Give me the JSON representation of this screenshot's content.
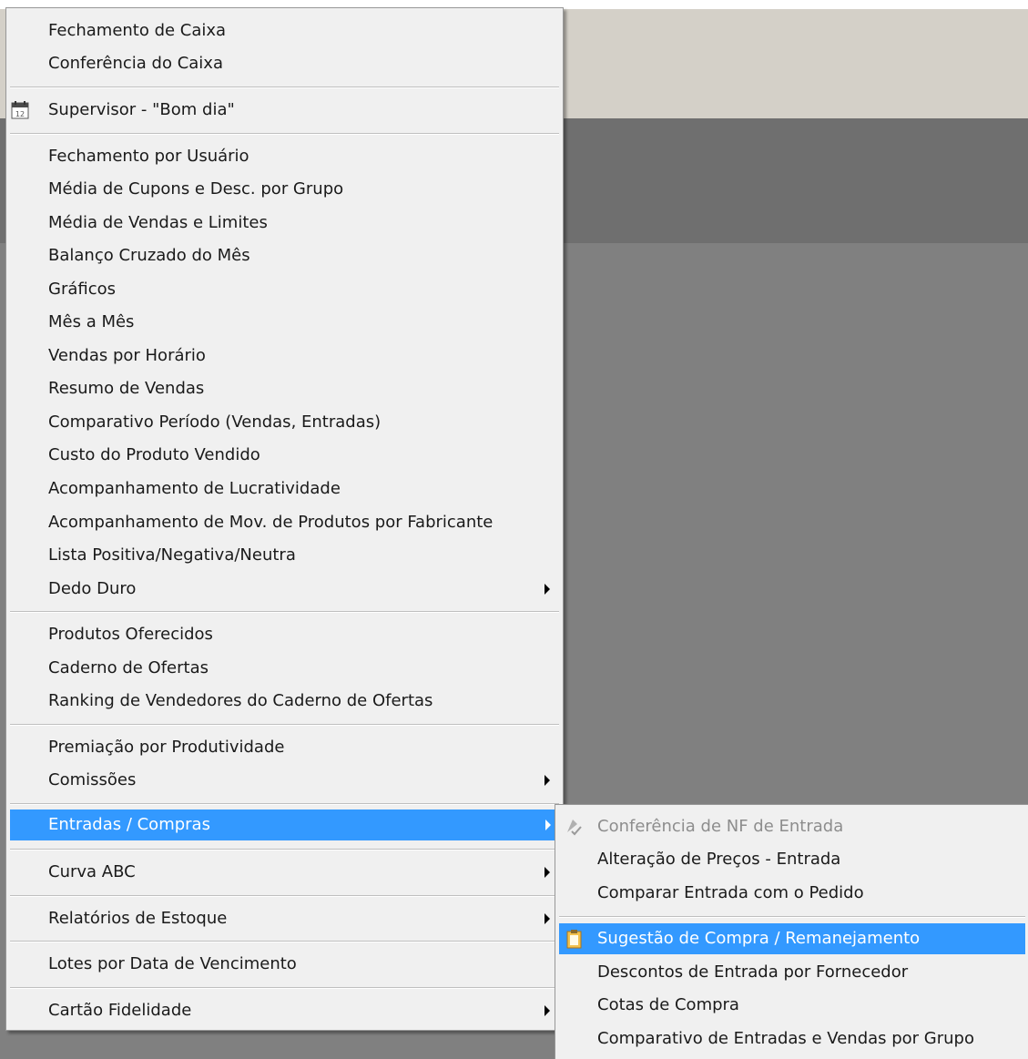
{
  "main_menu": {
    "items": [
      {
        "label": "Fechamento de Caixa"
      },
      {
        "label": "Conferência do Caixa"
      },
      {
        "label": "Supervisor - \"Bom dia\"",
        "icon": "calendar-icon"
      },
      {
        "label": "Fechamento por Usuário"
      },
      {
        "label": "Média de Cupons e Desc. por Grupo"
      },
      {
        "label": "Média de Vendas e Limites"
      },
      {
        "label": "Balanço Cruzado do Mês"
      },
      {
        "label": "Gráficos"
      },
      {
        "label": "Mês a Mês"
      },
      {
        "label": "Vendas por Horário"
      },
      {
        "label": "Resumo de Vendas"
      },
      {
        "label": "Comparativo Período (Vendas, Entradas)"
      },
      {
        "label": "Custo do Produto Vendido"
      },
      {
        "label": "Acompanhamento de Lucratividade"
      },
      {
        "label": "Acompanhamento de Mov. de Produtos por Fabricante"
      },
      {
        "label": "Lista Positiva/Negativa/Neutra"
      },
      {
        "label": "Dedo Duro",
        "submenu": true
      },
      {
        "label": "Produtos Oferecidos"
      },
      {
        "label": "Caderno de Ofertas"
      },
      {
        "label": "Ranking de Vendedores do Caderno de Ofertas"
      },
      {
        "label": "Premiação por Produtividade"
      },
      {
        "label": "Comissões",
        "submenu": true
      },
      {
        "label": "Entradas / Compras",
        "submenu": true,
        "highlighted": true
      },
      {
        "label": "Curva ABC",
        "submenu": true
      },
      {
        "label": "Relatórios de Estoque",
        "submenu": true
      },
      {
        "label": "Lotes por Data de Vencimento"
      },
      {
        "label": "Cartão Fidelidade",
        "submenu": true
      }
    ]
  },
  "sub_menu": {
    "items": [
      {
        "label": "Conferência de NF de Entrada",
        "disabled": true,
        "icon": "checklist-icon"
      },
      {
        "label": "Alteração de Preços - Entrada"
      },
      {
        "label": "Comparar Entrada com o  Pedido"
      },
      {
        "label": "Sugestão de Compra / Remanejamento",
        "highlighted": true,
        "icon": "clipboard-icon"
      },
      {
        "label": "Descontos de Entrada por Fornecedor"
      },
      {
        "label": "Cotas de Compra"
      },
      {
        "label": "Comparativo de Entradas e Vendas por Grupo"
      }
    ]
  },
  "colors": {
    "highlight": "#3399ff",
    "menu_bg": "#f0f0f0",
    "toolbar": "#d4d0c8"
  }
}
